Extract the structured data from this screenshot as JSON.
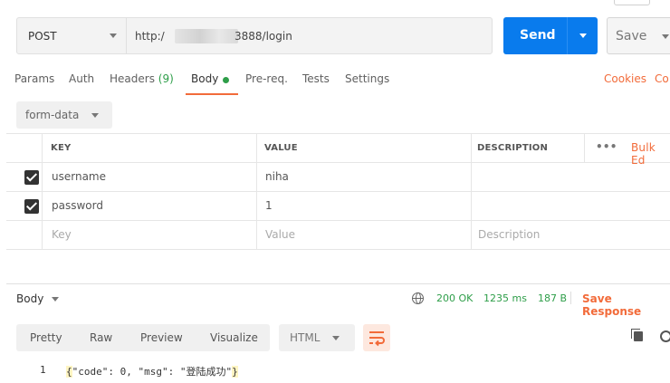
{
  "request": {
    "method": "POST",
    "url_prefix": "http:/",
    "url_suffix": "3888/login",
    "send_label": "Send",
    "save_label": "Save"
  },
  "tabs": {
    "params": "Params",
    "auth": "Auth",
    "headers": "Headers",
    "headers_count": "(9)",
    "body": "Body",
    "prereq": "Pre-req.",
    "tests": "Tests",
    "settings": "Settings",
    "cookies": "Cookies",
    "code": "Co"
  },
  "body_mode": {
    "selected": "form-data"
  },
  "table": {
    "headers": {
      "key": "KEY",
      "value": "VALUE",
      "description": "DESCRIPTION",
      "more": "•••",
      "bulk_edit": "Bulk Ed"
    },
    "rows": [
      {
        "key": "username",
        "value": "niha",
        "checked": true
      },
      {
        "key": "password",
        "value": "1",
        "checked": true
      }
    ],
    "placeholder": {
      "key": "Key",
      "value": "Value",
      "description": "Description"
    }
  },
  "response": {
    "title": "Body",
    "status": "200 OK",
    "time": "1235 ms",
    "size": "187 B",
    "save_response": "Save Response",
    "view_tabs": [
      "Pretty",
      "Raw",
      "Preview",
      "Visualize"
    ],
    "format": "HTML",
    "line_number": "1",
    "code_open": "{",
    "code_body": "\"code\": 0, \"msg\": \"登陆成功\"",
    "code_close": "}"
  },
  "colors": {
    "accent": "#097bed",
    "orange": "#f26b3a",
    "success": "#2e9e49"
  },
  "icons": [
    "chevron-down-icon",
    "check-icon",
    "globe-icon",
    "wrap-icon",
    "copy-icon",
    "search-icon"
  ]
}
